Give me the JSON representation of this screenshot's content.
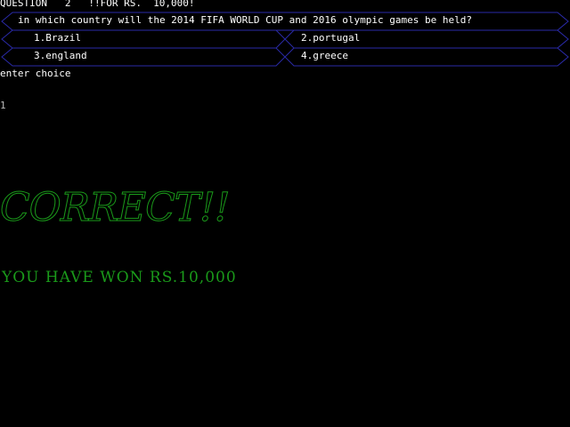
{
  "header": {
    "question_line": "QUESTION   2   !!FOR RS.  10,000!"
  },
  "question": {
    "text": "in which country will the 2014 FIFA WORLD CUP and 2016 olympic games be held?"
  },
  "options": [
    {
      "label": "1.Brazil"
    },
    {
      "label": "2.portugal"
    },
    {
      "label": "3.england"
    },
    {
      "label": "4.greece"
    }
  ],
  "prompt": {
    "text": "enter choice",
    "entered": "1"
  },
  "result": {
    "headline": "CORRECT!!",
    "message": "YOU HAVE WON RS.10,000"
  },
  "colors": {
    "frame": "#2a2aa8",
    "text": "#ffffff",
    "result": "#1a9a1a"
  }
}
